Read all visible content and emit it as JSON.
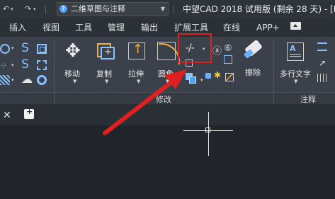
{
  "titlebar": {
    "workspace": "二维草图与注释",
    "app_title": "中望CAD 2018 试用版 (剩余 28 天) - [D"
  },
  "menu": {
    "items": [
      "插入",
      "视图",
      "工具",
      "管理",
      "输出",
      "扩展工具",
      "在线",
      "APP+"
    ]
  },
  "ribbon": {
    "modify": {
      "move": "移动",
      "copy": "复制",
      "stretch": "拉伸",
      "fillet": "圆角",
      "erase": "擦除",
      "title": "修改"
    },
    "annotate": {
      "mtext": "多行文字",
      "title": "注释"
    }
  },
  "colors": {
    "accent": "#4ea1ff",
    "highlight": "#e02020"
  }
}
